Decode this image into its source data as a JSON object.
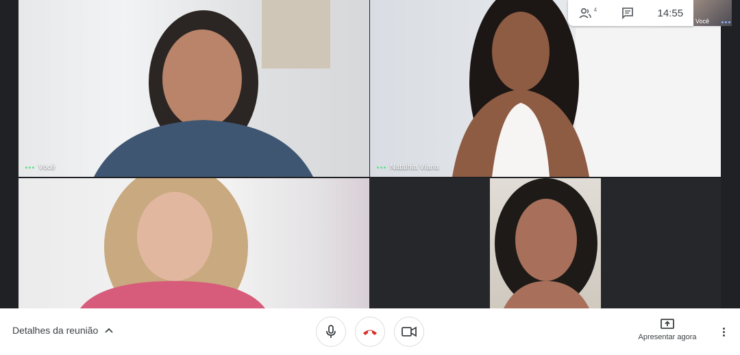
{
  "top_panel": {
    "participants_icon": "people-icon",
    "participants_count": "4",
    "chat_icon": "chat-icon",
    "clock": "14:55",
    "self_label": "Você"
  },
  "tiles": [
    {
      "name": "Você"
    },
    {
      "name": "Natalhia Viana"
    },
    {
      "name": ""
    },
    {
      "name": ""
    }
  ],
  "bottom_bar": {
    "meeting_details_label": "Detalhes da reunião",
    "mic_icon": "microphone-icon",
    "hangup_icon": "hang-up-icon",
    "camera_icon": "camera-icon",
    "present_label": "Apresentar agora",
    "more_icon": "more-vert-icon"
  },
  "colors": {
    "speaking_dots": "#5ce08a",
    "hangup_red": "#d93025",
    "background": "#202124"
  }
}
